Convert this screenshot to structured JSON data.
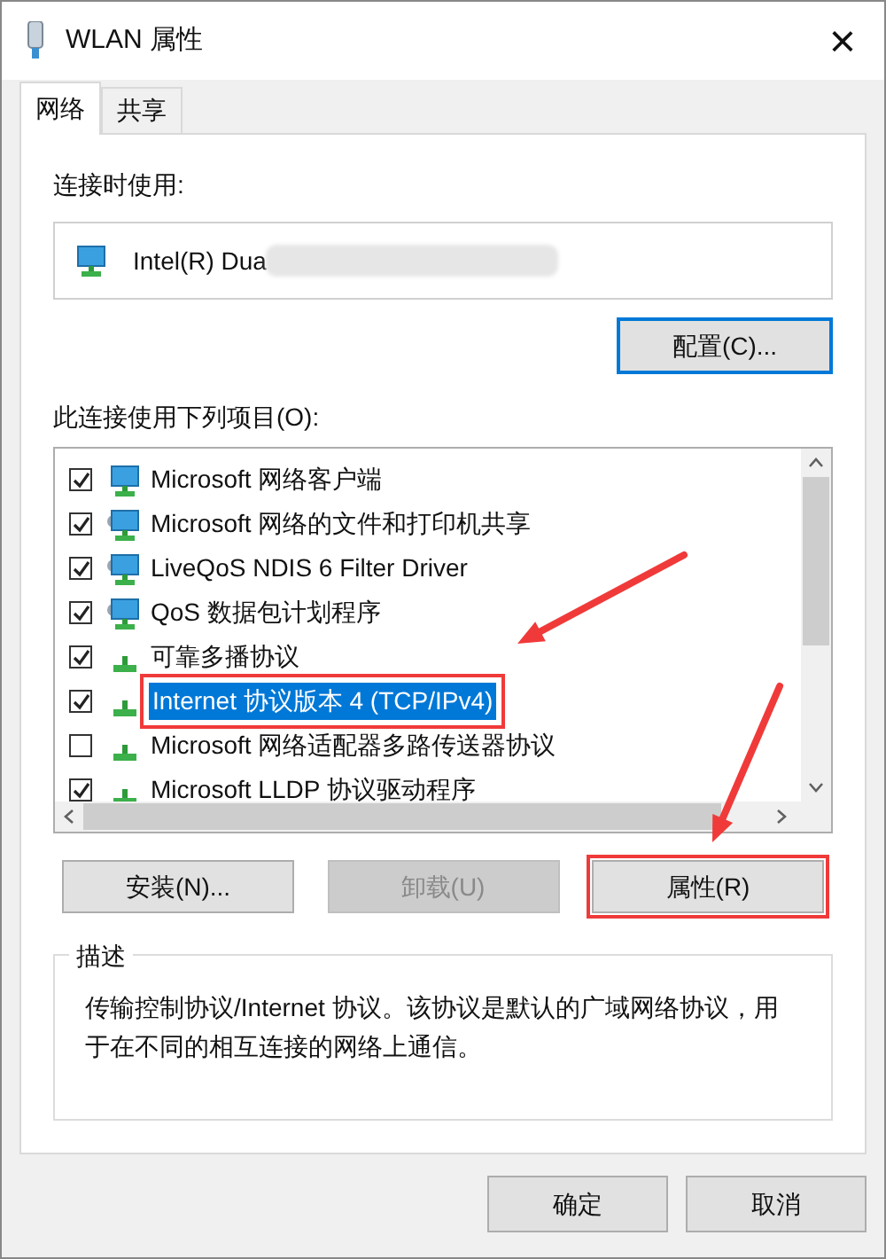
{
  "window": {
    "title": "WLAN 属性",
    "close": "×"
  },
  "tabs": [
    {
      "label": "网络",
      "selected": true
    },
    {
      "label": "共享",
      "selected": false
    }
  ],
  "connect_using": {
    "label": "连接时使用:",
    "adapter": "Intel(R) Dua",
    "configure_button": "配置(C)..."
  },
  "items_label": "此连接使用下列项目(O):",
  "items": [
    {
      "label": "Microsoft 网络客户端",
      "kind": "client",
      "checked": true,
      "selected": false,
      "highlighted": false
    },
    {
      "label": "Microsoft 网络的文件和打印机共享",
      "kind": "service",
      "checked": true,
      "selected": false,
      "highlighted": false
    },
    {
      "label": "LiveQoS NDIS 6 Filter Driver",
      "kind": "service",
      "checked": true,
      "selected": false,
      "highlighted": false
    },
    {
      "label": "QoS 数据包计划程序",
      "kind": "service",
      "checked": true,
      "selected": false,
      "highlighted": false
    },
    {
      "label": "可靠多播协议",
      "kind": "protocol",
      "checked": true,
      "selected": false,
      "highlighted": false
    },
    {
      "label": "Internet 协议版本 4 (TCP/IPv4)",
      "kind": "protocol",
      "checked": true,
      "selected": true,
      "highlighted": true
    },
    {
      "label": "Microsoft 网络适配器多路传送器协议",
      "kind": "protocol",
      "checked": false,
      "selected": false,
      "highlighted": false
    },
    {
      "label": "Microsoft LLDP 协议驱动程序",
      "kind": "protocol",
      "checked": true,
      "selected": false,
      "highlighted": false
    }
  ],
  "item_buttons": [
    {
      "label": "安装(N)...",
      "disabled": false,
      "highlighted": false
    },
    {
      "label": "卸载(U)",
      "disabled": true,
      "highlighted": false
    },
    {
      "label": "属性(R)",
      "disabled": false,
      "highlighted": true
    }
  ],
  "description": {
    "title": "描述",
    "text": "传输控制协议/Internet 协议。该协议是默认的广域网络协议，用于在不同的相互连接的网络上通信。"
  },
  "dialog_buttons": [
    "确定",
    "取消"
  ]
}
